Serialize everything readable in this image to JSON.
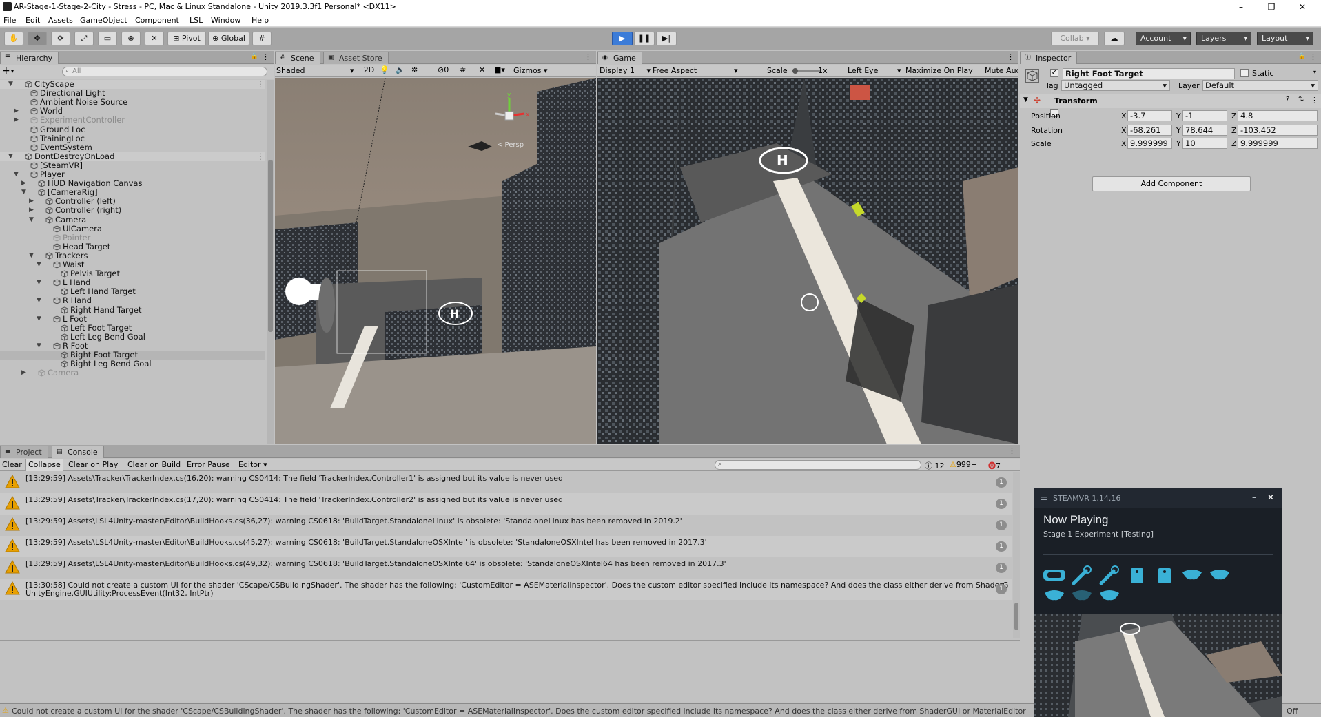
{
  "window": {
    "title": "AR-Stage-1-Stage-2-City - Stress - PC, Mac & Linux Standalone - Unity 2019.3.3f1 Personal* <DX11>",
    "minimize": "–",
    "restore": "❐",
    "close": "✕"
  },
  "menu": [
    "File",
    "Edit",
    "Assets",
    "GameObject",
    "Component",
    "LSL",
    "Window",
    "Help"
  ],
  "toolbar": {
    "pivot": "Pivot",
    "global": "Global",
    "collab": "Collab ▾",
    "account": "Account",
    "layers": "Layers",
    "layout": "Layout"
  },
  "hierarchy": {
    "tab": "Hierarchy",
    "add": "+",
    "search_placeholder": "All",
    "rows": [
      {
        "label": "CityScape",
        "indent": 0,
        "arrow": "▼",
        "kind": "scene"
      },
      {
        "label": "Directional Light",
        "indent": 1,
        "arrow": ""
      },
      {
        "label": "Ambient Noise Source",
        "indent": 1,
        "arrow": ""
      },
      {
        "label": "World",
        "indent": 1,
        "arrow": "▶"
      },
      {
        "label": "ExperimentController",
        "indent": 1,
        "arrow": "▶",
        "disabled": true
      },
      {
        "label": "Ground Loc",
        "indent": 1,
        "arrow": ""
      },
      {
        "label": "TrainingLoc",
        "indent": 1,
        "arrow": ""
      },
      {
        "label": "EventSystem",
        "indent": 1,
        "arrow": ""
      },
      {
        "label": "DontDestroyOnLoad",
        "indent": 0,
        "arrow": "▼",
        "kind": "scene"
      },
      {
        "label": "[SteamVR]",
        "indent": 1,
        "arrow": ""
      },
      {
        "label": "Player",
        "indent": 1,
        "arrow": "▼"
      },
      {
        "label": "HUD Navigation Canvas",
        "indent": 2,
        "arrow": "▶"
      },
      {
        "label": "[CameraRig]",
        "indent": 2,
        "arrow": "▼"
      },
      {
        "label": "Controller (left)",
        "indent": 3,
        "arrow": "▶"
      },
      {
        "label": "Controller (right)",
        "indent": 3,
        "arrow": "▶"
      },
      {
        "label": "Camera",
        "indent": 3,
        "arrow": "▼"
      },
      {
        "label": "UICamera",
        "indent": 4,
        "arrow": ""
      },
      {
        "label": "Pointer",
        "indent": 4,
        "arrow": "",
        "disabled": true
      },
      {
        "label": "Head Target",
        "indent": 4,
        "arrow": ""
      },
      {
        "label": "Trackers",
        "indent": 3,
        "arrow": "▼"
      },
      {
        "label": "Waist",
        "indent": 4,
        "arrow": "▼"
      },
      {
        "label": "Pelvis Target",
        "indent": 5,
        "arrow": ""
      },
      {
        "label": "L Hand",
        "indent": 4,
        "arrow": "▼"
      },
      {
        "label": "Left Hand Target",
        "indent": 5,
        "arrow": ""
      },
      {
        "label": "R Hand",
        "indent": 4,
        "arrow": "▼"
      },
      {
        "label": "Right Hand Target",
        "indent": 5,
        "arrow": ""
      },
      {
        "label": "L Foot",
        "indent": 4,
        "arrow": "▼"
      },
      {
        "label": "Left Foot Target",
        "indent": 5,
        "arrow": ""
      },
      {
        "label": "Left Leg Bend Goal",
        "indent": 5,
        "arrow": ""
      },
      {
        "label": "R Foot",
        "indent": 4,
        "arrow": "▼"
      },
      {
        "label": "Right Foot Target",
        "indent": 5,
        "arrow": "",
        "selected": true
      },
      {
        "label": "Right Leg Bend Goal",
        "indent": 5,
        "arrow": ""
      },
      {
        "label": "Camera",
        "indent": 2,
        "arrow": "▶",
        "disabled": true
      }
    ]
  },
  "scene": {
    "tab": "Scene",
    "tab2": "Asset Store",
    "shading": "Shaded",
    "mode2d": "2D",
    "hidden_count": "0",
    "gizmos": "Gizmos",
    "gizmo_persp": "< Persp"
  },
  "game": {
    "tab": "Game",
    "display": "Display 1",
    "aspect": "Free Aspect",
    "scale_label": "Scale",
    "scale_value": "1x",
    "eye": "Left Eye",
    "maximize": "Maximize On Play",
    "mute": "Mute Audi"
  },
  "inspector": {
    "tab": "Inspector",
    "object_name": "Right Foot Target",
    "static": "Static",
    "tag_label": "Tag",
    "tag": "Untagged",
    "layer_label": "Layer",
    "layer": "Default",
    "component": "Transform",
    "position_label": "Position",
    "rotation_label": "Rotation",
    "scale_label": "Scale",
    "axis_x": "X",
    "axis_y": "Y",
    "axis_z": "Z",
    "position": {
      "x": "-3.7",
      "y": "-1",
      "z": "4.8"
    },
    "rotation": {
      "x": "-68.261",
      "y": "78.644",
      "z": "-103.452"
    },
    "scale": {
      "x": "9.999999",
      "y": "10",
      "z": "9.999999"
    },
    "add_component": "Add Component"
  },
  "console": {
    "tab_project": "Project",
    "tab_console": "Console",
    "clear": "Clear",
    "collapse": "Collapse",
    "clear_on_play": "Clear on Play",
    "clear_on_build": "Clear on Build",
    "error_pause": "Error Pause",
    "editor": "Editor",
    "info_count": "12",
    "warn_count": "999+",
    "error_count": "7",
    "entries": [
      {
        "text": "[13:29:59] Assets\\Tracker\\TrackerIndex.cs(16,20): warning CS0414: The field 'TrackerIndex.Controller1' is assigned but its value is never used",
        "text2": "",
        "count": "1"
      },
      {
        "text": "[13:29:59] Assets\\Tracker\\TrackerIndex.cs(17,20): warning CS0414: The field 'TrackerIndex.Controller2' is assigned but its value is never used",
        "text2": "",
        "count": "1"
      },
      {
        "text": "[13:29:59] Assets\\LSL4Unity-master\\Editor\\BuildHooks.cs(36,27): warning CS0618: 'BuildTarget.StandaloneLinux' is obsolete: 'StandaloneLinux has been removed in 2019.2'",
        "text2": "",
        "count": "1"
      },
      {
        "text": "[13:29:59] Assets\\LSL4Unity-master\\Editor\\BuildHooks.cs(45,27): warning CS0618: 'BuildTarget.StandaloneOSXIntel' is obsolete: 'StandaloneOSXIntel has been removed in 2017.3'",
        "text2": "",
        "count": "1"
      },
      {
        "text": "[13:29:59] Assets\\LSL4Unity-master\\Editor\\BuildHooks.cs(49,32): warning CS0618: 'BuildTarget.StandaloneOSXIntel64' is obsolete: 'StandaloneOSXIntel64 has been removed in 2017.3'",
        "text2": "",
        "count": "1"
      },
      {
        "text": "[13:30:58] Could not create a custom UI for the shader 'CScape/CSBuildingShader'. The shader has the following: 'CustomEditor = ASEMaterialInspector'. Does the custom editor specified include its namespace? And does the class either derive from ShaderG",
        "text2": "UnityEngine.GUIUtility:ProcessEvent(Int32, IntPtr)",
        "count": "1"
      }
    ]
  },
  "statusbar": {
    "message": "Could not create a custom UI for the shader 'CScape/CSBuildingShader'. The shader has the following: 'CustomEditor = ASEMaterialInspector'. Does the custom editor specified include its namespace? And does the class either derive from ShaderGUI or MaterialEditor",
    "right": "Off"
  },
  "steamvr": {
    "title": "STEAMVR 1.14.16",
    "heading": "Now Playing",
    "subheading": "Stage 1 Experiment [Testing]",
    "icon_row1": [
      "headset-icon",
      "controller-icon",
      "controller-icon",
      "base-station-icon",
      "base-station-icon",
      "tracker-icon",
      "tracker-icon"
    ],
    "icon_row2": [
      "tracker-icon",
      "tracker-icon",
      "tracker-icon"
    ],
    "accent": "#3ab1d6"
  },
  "colors": {
    "editor_bg": "#c2c2c2",
    "toolbar_bg": "#a5a5a5",
    "play_active": "#3c7cd8",
    "warning": "#e8a000",
    "error": "#d03030"
  }
}
